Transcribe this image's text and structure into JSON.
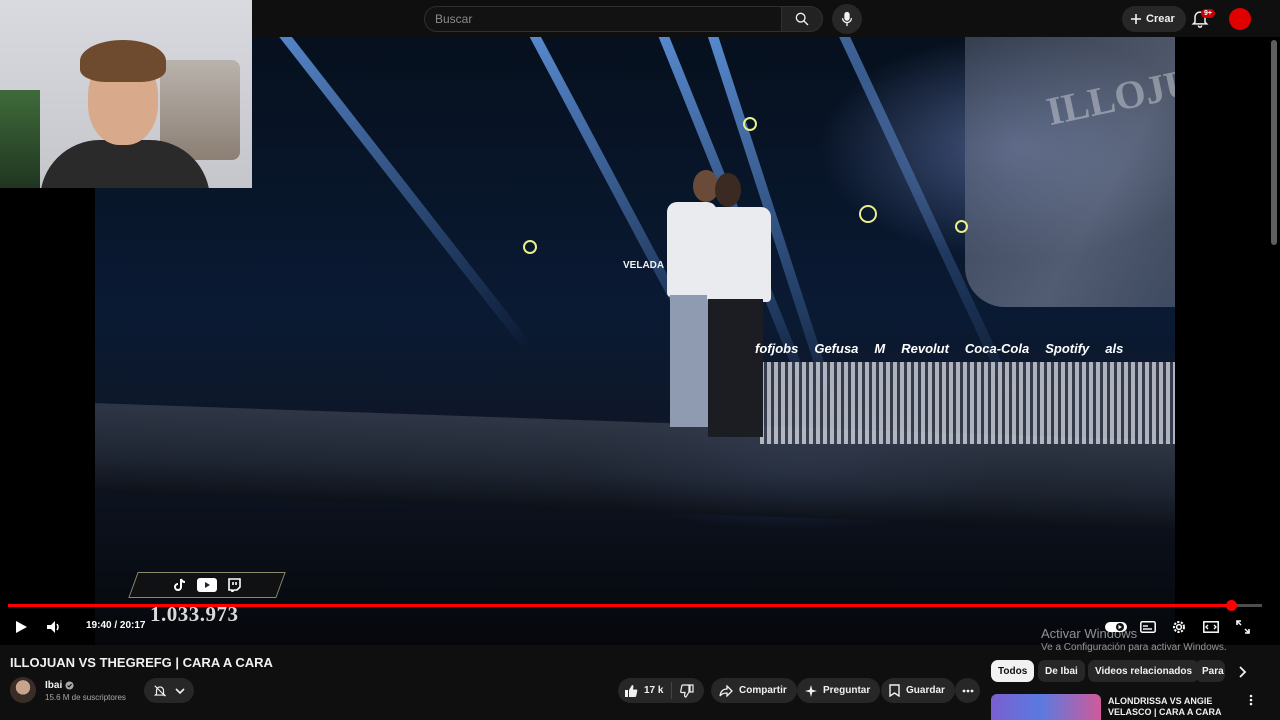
{
  "header": {
    "search_placeholder": "Buscar",
    "create_label": "Crear",
    "notifications_badge": "9+"
  },
  "video": {
    "counter_value": "1.033.973",
    "sponsors": [
      "fofjobs",
      "Gefusa",
      "M",
      "Revolut",
      "Coca-Cola",
      "Spotify",
      "als"
    ],
    "stage_screen_text": "ILLOJUAN",
    "logo_text": "VELADA DEL AÑO"
  },
  "player": {
    "time_label": "19:40 / 20:17",
    "progress": 0.975,
    "watermark_line1": "Activar Windows",
    "watermark_line2": "Ve a Configuración para activar Windows."
  },
  "info": {
    "title": "ILLOJUAN VS THEGREFG | CARA A CARA",
    "channel_name": "Ibai",
    "subscribers": "15.6 M de suscriptores",
    "likes": "17 k",
    "share_label": "Compartir",
    "ask_label": "Preguntar",
    "save_label": "Guardar"
  },
  "chips": [
    "Todos",
    "De Ibai",
    "Videos relacionados",
    "Para"
  ],
  "recommendation": {
    "title": "ALONDRISSA VS ANGIE VELASCO | CARA A CARA"
  },
  "colors": {
    "accent": "#ff0000",
    "background": "#0f0f0f",
    "surface": "#272727"
  }
}
